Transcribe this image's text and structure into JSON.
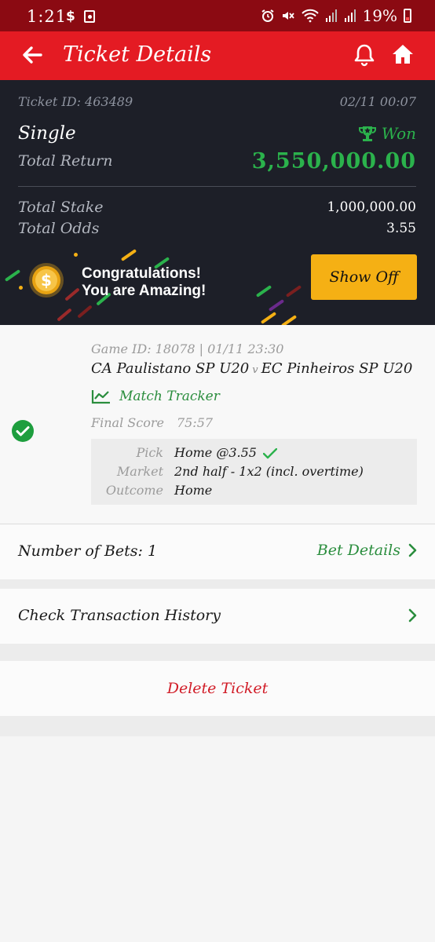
{
  "status_bar": {
    "time": "1:21",
    "app_s_icon": "s-app-icon",
    "app_box_icon": "media-app-icon",
    "icons": [
      "alarm-icon",
      "mute-icon",
      "wifi-icon",
      "signal-icon",
      "signal-icon"
    ],
    "battery": "19%"
  },
  "app_bar": {
    "title": "Ticket Details",
    "background_color": "#e41b23"
  },
  "ticket": {
    "id_label": "Ticket ID: 463489",
    "date": "02/11 00:07",
    "type": "Single",
    "status": "Won",
    "status_color": "#2bb24c",
    "total_return_label": "Total Return",
    "total_return_value": "3,550,000.00",
    "total_stake_label": "Total Stake",
    "total_stake_value": "1,000,000.00",
    "total_odds_label": "Total Odds",
    "total_odds_value": "3.55"
  },
  "promo": {
    "line1": "Congratulations!",
    "line2": "You are Amazing!",
    "button": "Show Off",
    "button_color": "#f5b014"
  },
  "bet": {
    "game_id": "Game ID: 18078 | 01/11 23:30",
    "home_team": "CA Paulistano SP U20",
    "vs": "v",
    "away_team": "EC Pinheiros SP U20",
    "match_tracker": "Match Tracker",
    "final_score_label": "Final Score",
    "final_score_value": "75:57",
    "pick_label": "Pick",
    "pick_value": "Home @3.55",
    "market_label": "Market",
    "market_value": "2nd half - 1x2 (incl. overtime)",
    "outcome_label": "Outcome",
    "outcome_value": "Home"
  },
  "summary": {
    "number_of_bets": "Number of Bets: 1",
    "bet_details": "Bet Details",
    "transaction_history": "Check Transaction History",
    "delete_ticket": "Delete Ticket"
  }
}
